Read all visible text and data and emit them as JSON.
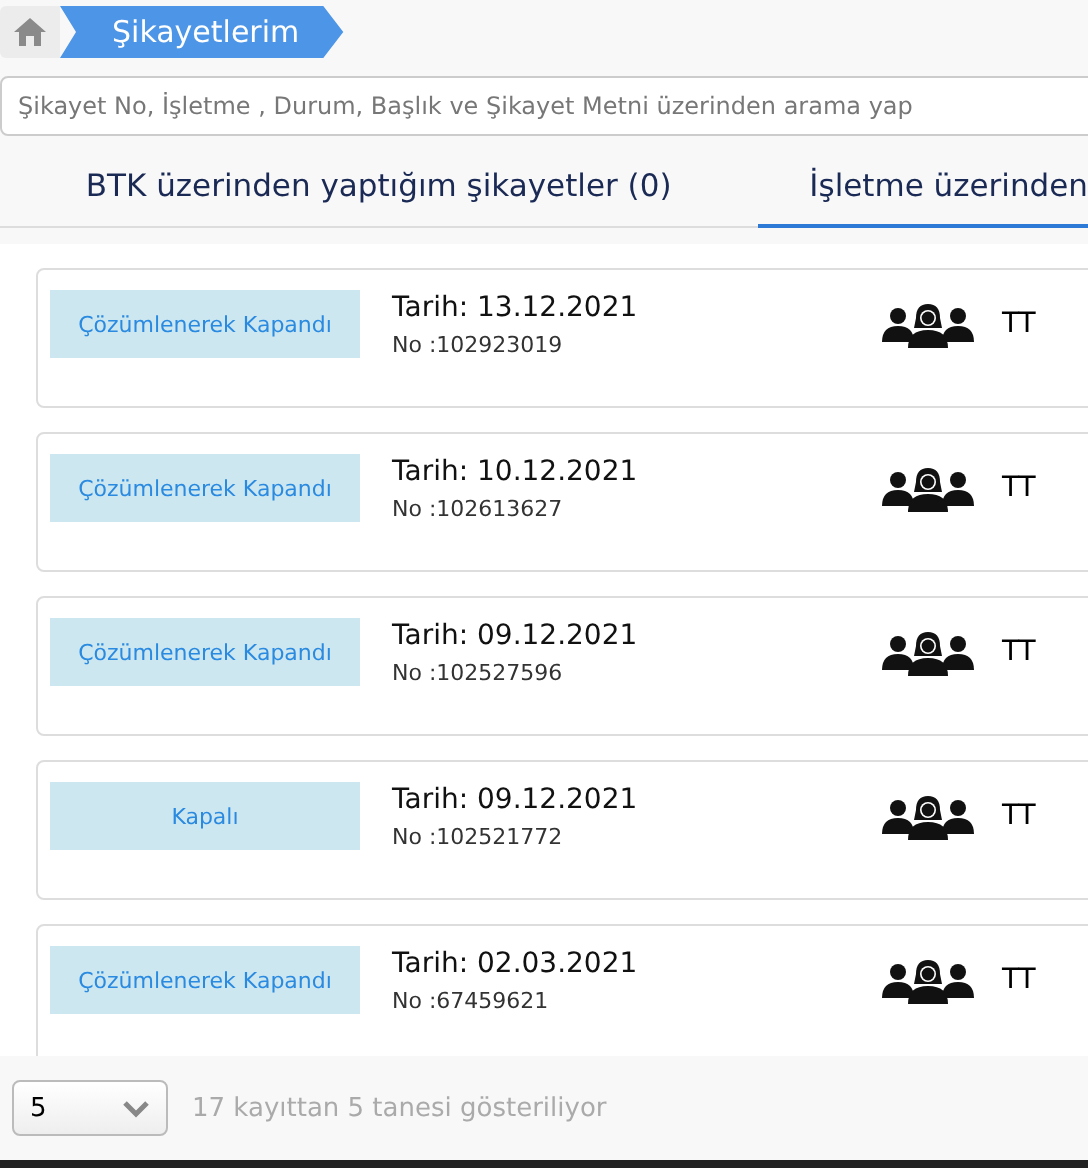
{
  "breadcrumb": {
    "title": "Şikayetlerim"
  },
  "search": {
    "placeholder": "Şikayet No, İşletme , Durum, Başlık ve Şikayet Metni üzerinden arama yap"
  },
  "tabs": [
    {
      "label": "BTK üzerinden yaptığım şikayetler (0)",
      "selected": false
    },
    {
      "label": "İşletme üzerinden",
      "selected": true
    }
  ],
  "complaints": [
    {
      "status": "Çözümlenerek Kapandı",
      "date": "Tarih: 13.12.2021",
      "no": "No :102923019",
      "operator": "TT"
    },
    {
      "status": "Çözümlenerek Kapandı",
      "date": "Tarih: 10.12.2021",
      "no": "No :102613627",
      "operator": "TT"
    },
    {
      "status": "Çözümlenerek Kapandı",
      "date": "Tarih: 09.12.2021",
      "no": "No :102527596",
      "operator": "TT"
    },
    {
      "status": "Kapalı",
      "date": "Tarih: 09.12.2021",
      "no": "No :102521772",
      "operator": "TT"
    },
    {
      "status": "Çözümlenerek Kapandı",
      "date": "Tarih: 02.03.2021",
      "no": "No :67459621",
      "operator": "TT"
    }
  ],
  "footer": {
    "page_size": "5",
    "summary": "17 kayıttan 5 tanesi gösteriliyor"
  }
}
